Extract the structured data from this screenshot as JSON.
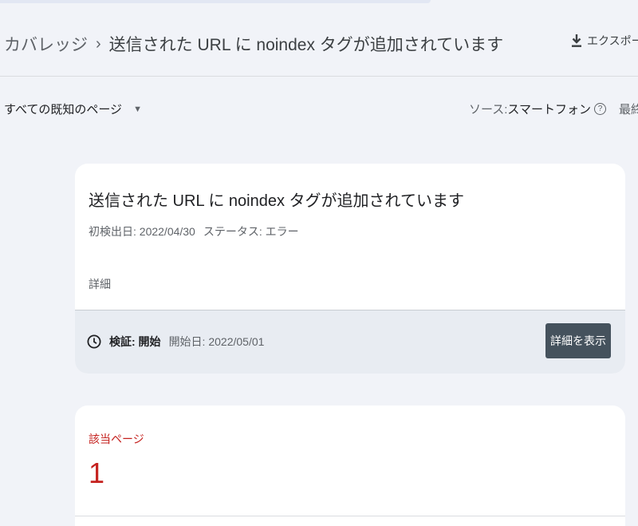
{
  "header": {
    "breadcrumb_root": "カバレッジ",
    "breadcrumb_separator": "›",
    "breadcrumb_current": "送信された URL に noindex タグが追加されています",
    "export_label": "エクスポー"
  },
  "toolbar": {
    "page_filter": "すべての既知のページ",
    "source_label": "ソース: ",
    "source_value": "スマートフォン",
    "help_glyph": "?",
    "updated_label": "最終更新日"
  },
  "issue_card": {
    "title": "送信された URL に noindex タグが追加されています",
    "first_detected": "初検出日: 2022/04/30",
    "status": "ステータス: エラー",
    "details_label": "詳細",
    "validation_label": "検証: 開始",
    "validation_start": "開始日: 2022/05/01",
    "details_button": "詳細を表示"
  },
  "affected_card": {
    "label": "該当ページ",
    "count": "1"
  },
  "colors": {
    "background": "#f1f3f8",
    "error_red": "#c5221f",
    "button_dark": "#45525d",
    "footer_gray": "#e8ecf2"
  },
  "icons": {
    "export": "download-icon",
    "dropdown": "caret-down-icon",
    "help": "help-circle-icon",
    "validation": "clock-icon"
  }
}
